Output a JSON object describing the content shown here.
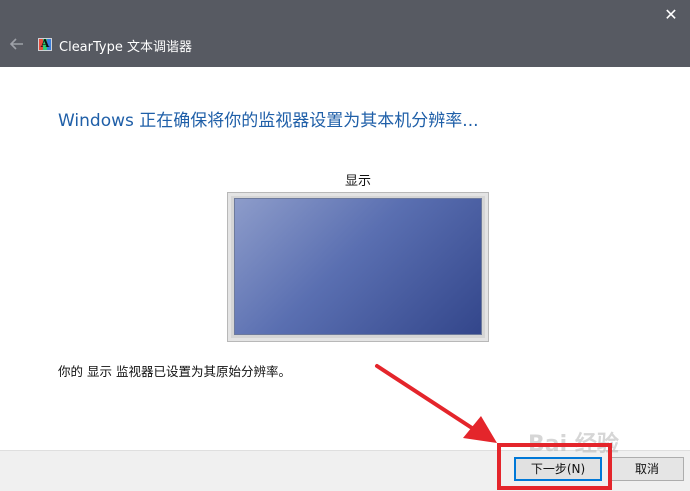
{
  "window": {
    "title": "ClearType 文本调谐器",
    "close_icon": "close-icon",
    "back_icon": "back-arrow-icon"
  },
  "main": {
    "heading": "Windows 正在确保将你的监视器设置为其本机分辨率...",
    "monitor_label": "显示",
    "status_text": "你的 显示 监视器已设置为其原始分辨率。"
  },
  "buttons": {
    "next_label": "下一步(N)",
    "cancel_label": "取消"
  },
  "annotation": {
    "watermark": "Bai 经验",
    "highlight_color": "#e4252b"
  },
  "colors": {
    "titlebar": "#575a62",
    "heading": "#1f5fa8",
    "screen_gradient_start": "#8d9cca",
    "screen_gradient_end": "#33468b"
  }
}
